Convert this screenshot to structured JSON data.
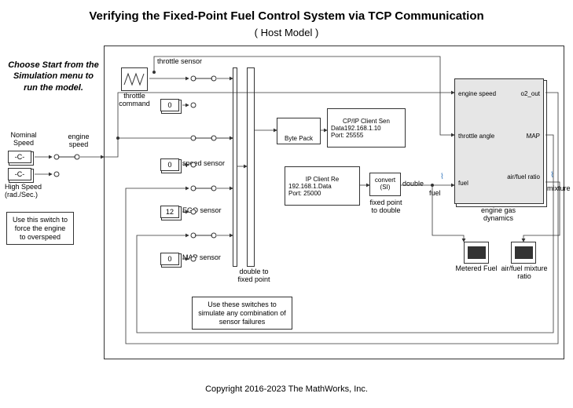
{
  "title": "Verifying the Fixed-Point Fuel Control System via TCP Communication",
  "subtitle": "( Host Model )",
  "note_start": "Choose Start from the Simulation menu to run the model.",
  "left": {
    "nominal_speed": "Nominal Speed",
    "c1": "-C-",
    "c2": "-C-",
    "high_speed": "High Speed (rad./Sec.)",
    "engine_speed": "engine speed",
    "overspeed_note": "Use this switch to force the engine to overspeed"
  },
  "sensors": {
    "throttle_cmd": "throttle command",
    "throttle_sensor": "throttle sensor",
    "throttle_val": "0",
    "speed_sensor": "speed sensor",
    "speed_val": "0",
    "ego_sensor": "EGO sensor",
    "ego_val": "12",
    "map_sensor": "MAP sensor",
    "map_val": "0",
    "failure_note": "Use these switches to simulate any combination of sensor failures"
  },
  "mux": {
    "d2fp": "double to fixed point"
  },
  "tcp": {
    "byte_pack": "Byte Pack",
    "send": "CP/IP Client Sen",
    "send_ip": "192.168.1.10",
    "send_port": "Port: 25555",
    "send_data": "Data",
    "recv": "IP Client Re",
    "recv_ip": "192.168.1.",
    "recv_port": "Port: 25000",
    "recv_data": "Data"
  },
  "convert": {
    "label": "convert (SI)",
    "out": "double",
    "fuel": "fuel",
    "fp2d": "fixed point to double"
  },
  "engine": {
    "name": "engine gas dynamics",
    "in1": "engine speed",
    "in2": "throttle angle",
    "in3": "fuel",
    "out1": "o2_out",
    "out2": "MAP",
    "out3": "air/fuel ratio",
    "mixture": "mixture"
  },
  "scopes": {
    "metered": "Metered Fuel",
    "afr": "air/fuel mixture ratio"
  },
  "copyright": "Copyright 2016-2023 The MathWorks, Inc."
}
